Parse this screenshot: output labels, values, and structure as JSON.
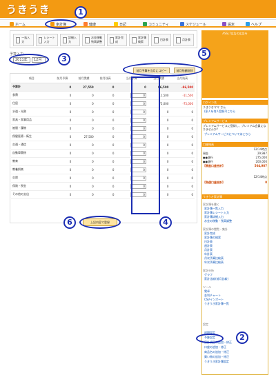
{
  "app": {
    "logo": "うきうき"
  },
  "nav": [
    {
      "label": "ホーム",
      "icon": "home-icon"
    },
    {
      "label": "家計簿",
      "icon": "household-book-icon"
    },
    {
      "label": "健康",
      "icon": "health-icon"
    },
    {
      "label": "日記",
      "icon": "diary-icon"
    },
    {
      "label": "コミュニティ",
      "icon": "community-icon"
    },
    {
      "label": "スケジュール",
      "icon": "schedule-icon"
    },
    {
      "label": "設定",
      "icon": "settings-icon"
    },
    {
      "label": "ヘルプ",
      "icon": "help-icon"
    }
  ],
  "toolbar": [
    {
      "label": "一括入力",
      "icon": "bulk-input-icon"
    },
    {
      "label": "レシート入力",
      "icon": "receipt-input-icon"
    },
    {
      "label": "詳細入力",
      "icon": "detail-input-icon"
    },
    {
      "label": "お金移動\n残高調整",
      "icon": "money-transfer-icon"
    },
    {
      "label": "家計完成",
      "icon": "household-complete-icon"
    },
    {
      "label": "家計簿\n検索",
      "icon": "search-icon"
    },
    {
      "label": "日計表",
      "icon": "daily-report-icon"
    },
    {
      "label": "月計表",
      "icon": "monthly-report-icon"
    }
  ],
  "budget": {
    "title": "予算入力",
    "year": "2011年",
    "month": "12月",
    "copy_button": "前月予算を当月にコピー",
    "delete_button": "前月残額削除",
    "save_button": "上記内容で登録"
  },
  "table": {
    "headers": [
      "項目",
      "前月予算",
      "前月実績",
      "前月残高",
      "当月予算",
      "当月実績",
      "当月残高"
    ],
    "total": {
      "label": "予算計",
      "values": [
        "0",
        "27,550",
        "0",
        "0",
        "86,500",
        "-86,500"
      ]
    },
    "rows": [
      {
        "label": "食費",
        "values": [
          "0",
          "0",
          "0",
          "0",
          "11,500",
          "-11,500"
        ]
      },
      {
        "label": "住居",
        "values": [
          "0",
          "0",
          "0",
          "0",
          "75,000",
          "-75,000"
        ]
      },
      {
        "label": "水道・光熱",
        "values": [
          "0",
          "0",
          "0",
          "0",
          "0",
          "0"
        ]
      },
      {
        "label": "家具・家事用品",
        "values": [
          "0",
          "0",
          "0",
          "0",
          "0",
          "0"
        ]
      },
      {
        "label": "被服・履物",
        "values": [
          "0",
          "0",
          "0",
          "0",
          "0",
          "0"
        ]
      },
      {
        "label": "保健医療・衛生",
        "values": [
          "0",
          "27,500",
          "0",
          "0",
          "0",
          "0"
        ]
      },
      {
        "label": "交通・通信",
        "values": [
          "0",
          "0",
          "0",
          "0",
          "0",
          "0"
        ]
      },
      {
        "label": "自動車関係",
        "values": [
          "0",
          "0",
          "0",
          "0",
          "0",
          "0"
        ]
      },
      {
        "label": "教育",
        "values": [
          "0",
          "0",
          "0",
          "0",
          "0",
          "0"
        ]
      },
      {
        "label": "教養娯楽",
        "values": [
          "0",
          "0",
          "0",
          "0",
          "0",
          "0"
        ]
      },
      {
        "label": "交際",
        "values": [
          "0",
          "0",
          "0",
          "0",
          "0",
          "0"
        ]
      },
      {
        "label": "保険・税金",
        "values": [
          "0",
          "0",
          "0",
          "0",
          "0",
          "0"
        ]
      },
      {
        "label": "その他の支出",
        "values": [
          "0",
          "0",
          "0",
          "0",
          "0",
          "0"
        ]
      }
    ]
  },
  "sidebar": {
    "banner": "ASSL7広告の広告を",
    "login_header": "ログイン名",
    "login_text": "うきうきママ さん",
    "login_sub": "(家人を何人登録?)こちら",
    "premium_header": "プレミアムサービス",
    "premium_text": "プレミアムサービスに登録し、プレミアム会員になりませんか？",
    "premium_link": "プレミアムサービスについてはこちら",
    "account_header": "口座残高",
    "account_date": "12/14時点",
    "account_rows": [
      {
        "label": "現金",
        "value": "29,987"
      },
      {
        "label": "●●銀行",
        "value": "275,000"
      },
      {
        "label": "●●銀行",
        "value": "200,000"
      },
      {
        "label": "【資産口座合計】",
        "value": "504,987"
      }
    ],
    "debt_date": "12/14時点",
    "debt_total": "【負債口座合計】",
    "debt_value": "0",
    "menu_header": "うきうき家計簿",
    "sections": [
      {
        "title": "家計簿を書く",
        "items": [
          "家計簿一覧入力",
          "家計簿レシート入力",
          "家計簿詳細入力",
          "お金の移動・残高調整"
        ]
      },
      {
        "title": "家計簿の閲覧・集計",
        "items": [
          "家計完成",
          "家計簿の検索",
          "日計表",
          "週計表",
          "月計表",
          "年計表",
          "月次予算比較表",
          "年次予算比較表"
        ]
      },
      {
        "title": "家計分析",
        "items": [
          "グラフ",
          "家計比較(前月比較)"
        ]
      },
      {
        "title": "ツール",
        "items": [
          "電卓",
          "金利チャート",
          "CSVインポート",
          "うきうき家計簿一覧"
        ]
      },
      {
        "title": "設定",
        "items": [
          "初期設定",
          "予算設定",
          "家計項目の追加・修正",
          "口座の追加・修正",
          "商品名の追加・修正",
          "買い物の追加・修正",
          "うきうき家計簿設定"
        ]
      }
    ]
  },
  "annotations": [
    "1",
    "2",
    "3",
    "4",
    "5",
    "6"
  ]
}
